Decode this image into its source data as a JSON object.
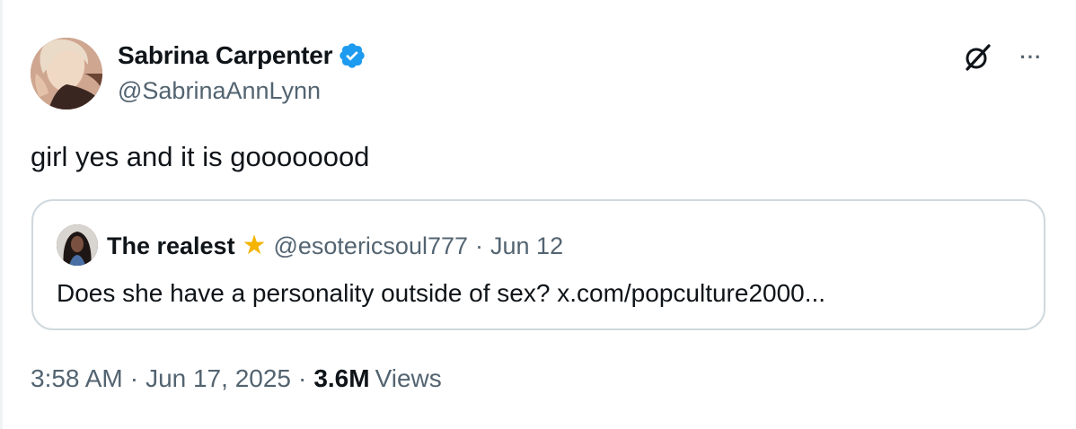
{
  "tweet": {
    "author": {
      "display_name": "Sabrina Carpenter",
      "handle": "@SabrinaAnnLynn",
      "verified": true,
      "verified_color": "#1d9bf0"
    },
    "text": "girl yes and it is goooooood",
    "timestamp_time": "3:58 AM",
    "timestamp_date": "Jun 17, 2025",
    "separator": "·",
    "views_count": "3.6M",
    "views_label": "Views",
    "actions": {
      "grok_icon": "grok-icon",
      "more_label": "···"
    }
  },
  "quoted_tweet": {
    "display_name": "The realest",
    "badge_icon": "star-icon",
    "badge_glyph": "★",
    "handle": "@esotericsoul777",
    "separator": "·",
    "date": "Jun 12",
    "text": "Does she have a personality outside of sex? x.com/popculture2000..."
  },
  "colors": {
    "text_primary": "#0f1419",
    "text_secondary": "#536471",
    "border": "#cfd9de",
    "star": "#f4b400"
  }
}
